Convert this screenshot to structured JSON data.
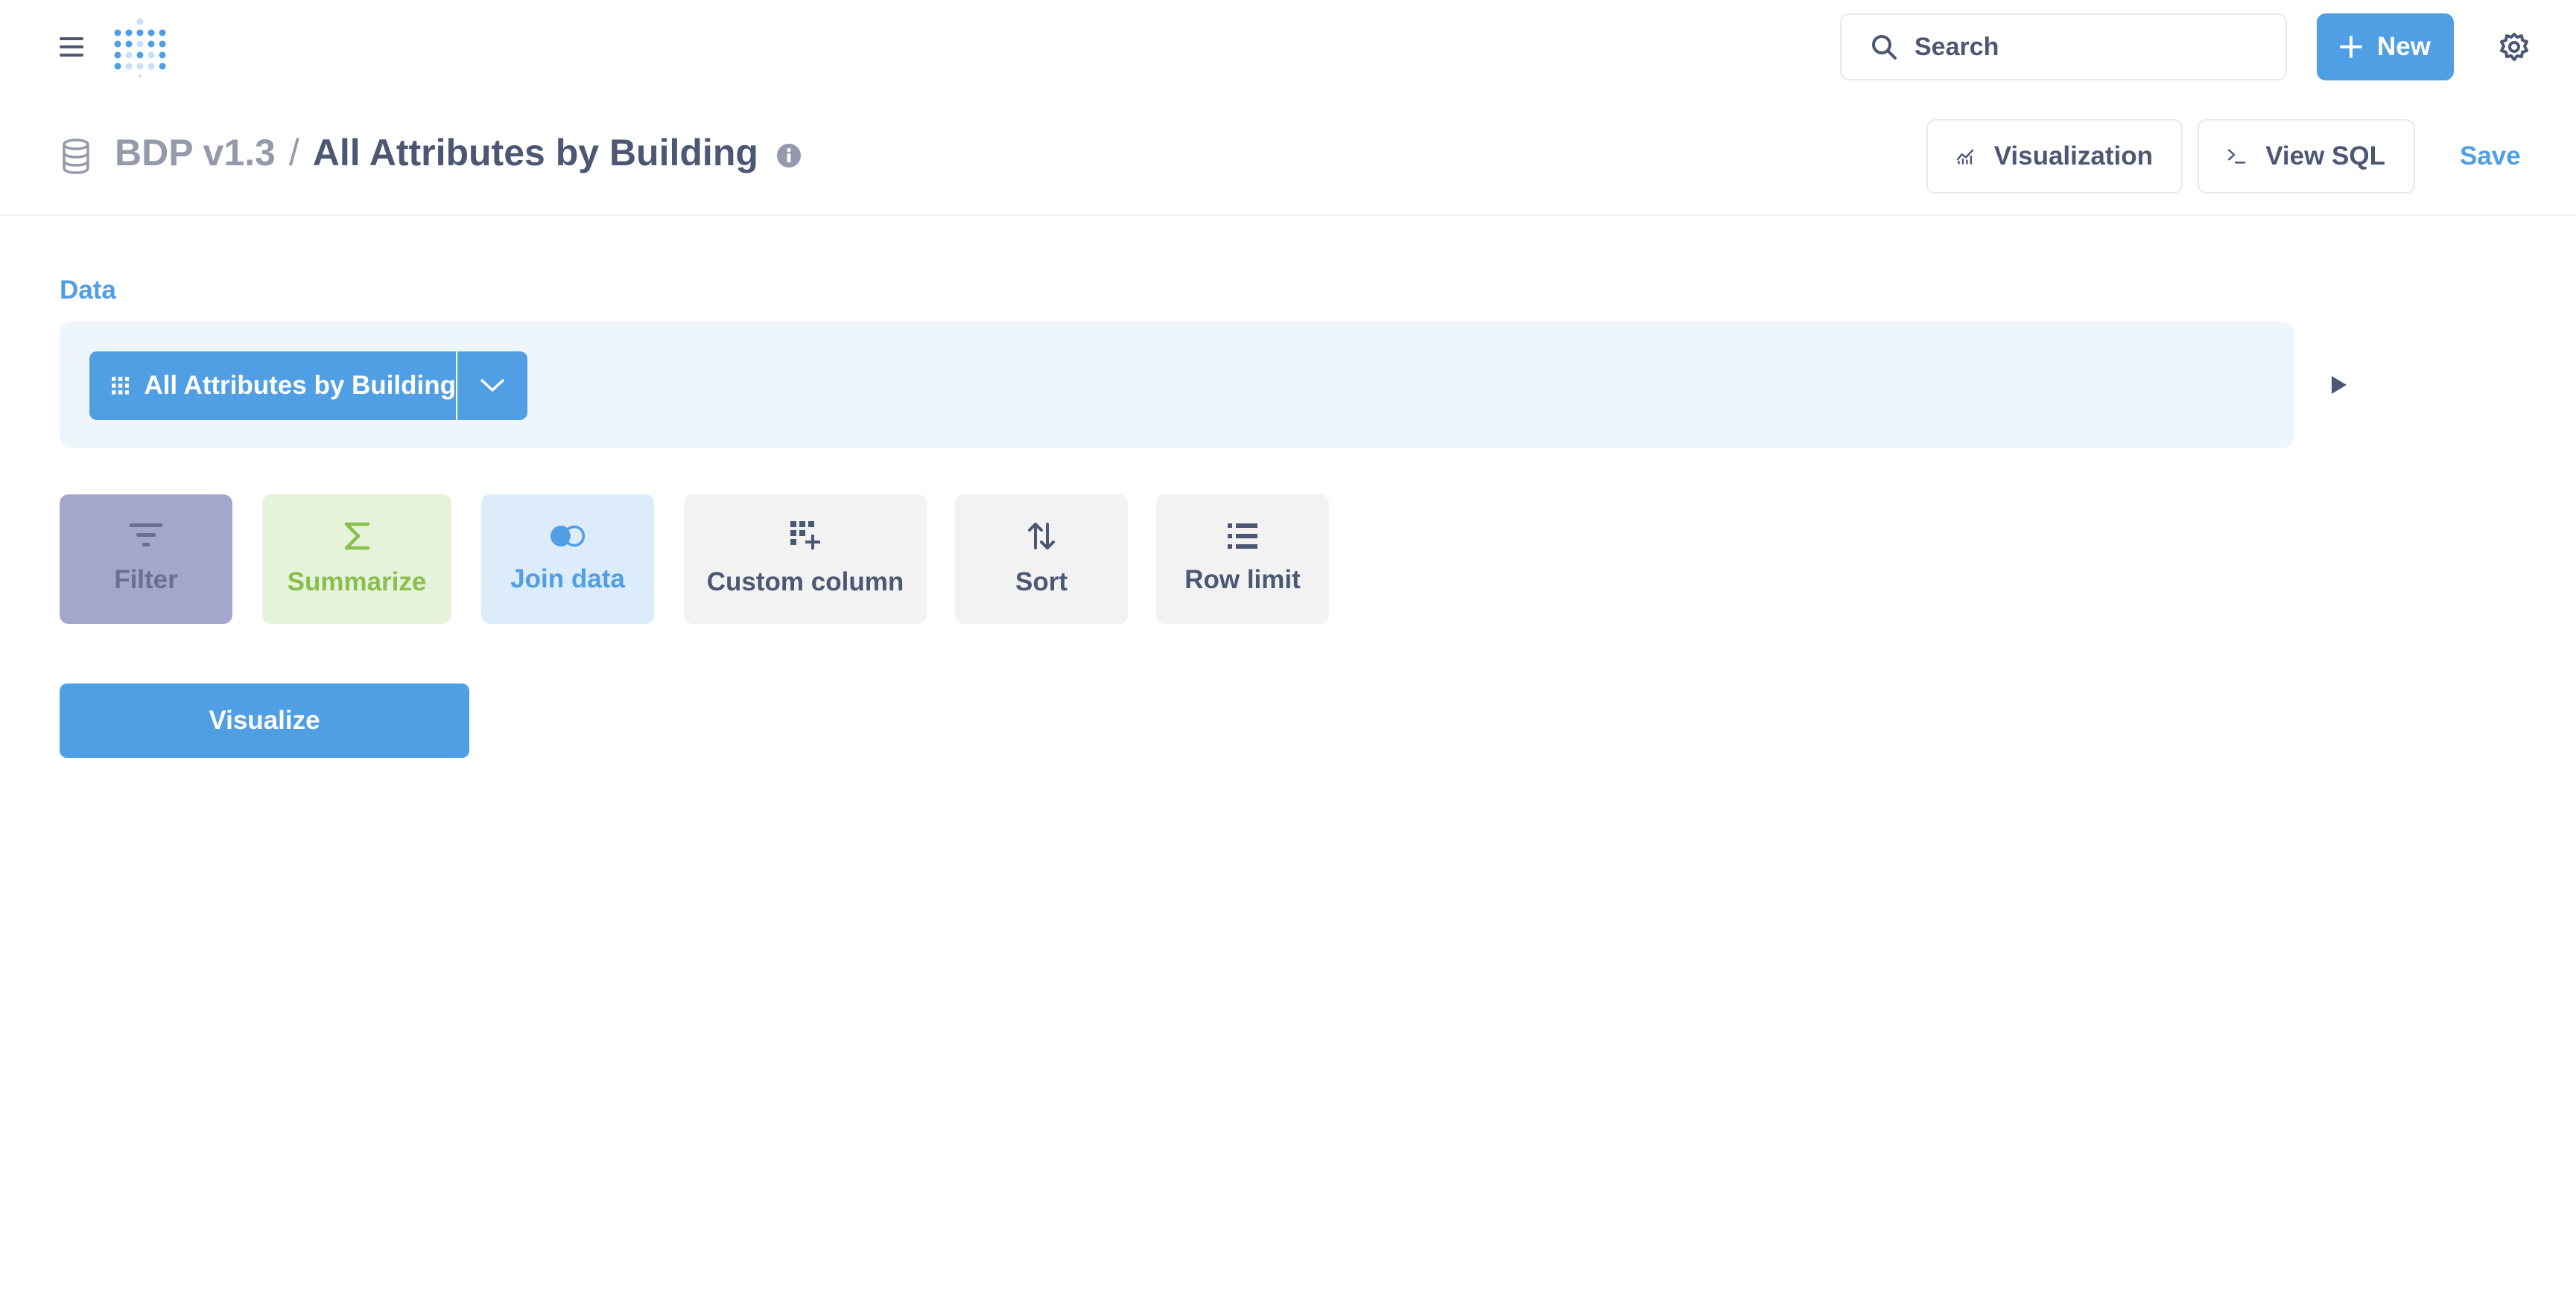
{
  "nav": {
    "menu_icon": "hamburger-icon",
    "logo_icon": "metabase-logo",
    "search": {
      "placeholder": "Search",
      "icon": "search-icon"
    },
    "new_button": {
      "label": "New",
      "icon": "plus-icon"
    },
    "settings_icon": "gear-icon"
  },
  "header": {
    "database_icon": "database-icon",
    "database_name": "BDP v1.3",
    "separator": "/",
    "question_title": "All Attributes by Building",
    "info_icon": "info-icon",
    "visualization_button": {
      "label": "Visualization",
      "icon": "line-chart-icon"
    },
    "view_sql_button": {
      "label": "View SQL",
      "icon": "terminal-icon"
    },
    "save_label": "Save"
  },
  "data_section": {
    "label": "Data",
    "source": {
      "label": "All Attributes by Building",
      "icon": "grid-icon",
      "caret_icon": "chevron-down-icon"
    },
    "run_icon": "play-icon"
  },
  "steps": [
    {
      "label": "Filter",
      "icon": "filter-icon"
    },
    {
      "label": "Summarize",
      "icon": "sigma-icon"
    },
    {
      "label": "Join data",
      "icon": "join-icon"
    },
    {
      "label": "Custom column",
      "icon": "add-column-icon"
    },
    {
      "label": "Sort",
      "icon": "sort-icon"
    },
    {
      "label": "Row limit",
      "icon": "list-icon"
    }
  ],
  "visualize_button": {
    "label": "Visualize"
  },
  "colors": {
    "brand": "#509ee3",
    "text_dark": "#4c5773",
    "text_muted": "#949aab",
    "filter_bg": "#a5a6cb",
    "summarize_bg": "#e7f2da",
    "summarize_fg": "#88bf4d",
    "join_bg": "#ddecfa",
    "neutral_bg": "#f2f2f2",
    "data_panel_bg": "#eef6fc"
  }
}
